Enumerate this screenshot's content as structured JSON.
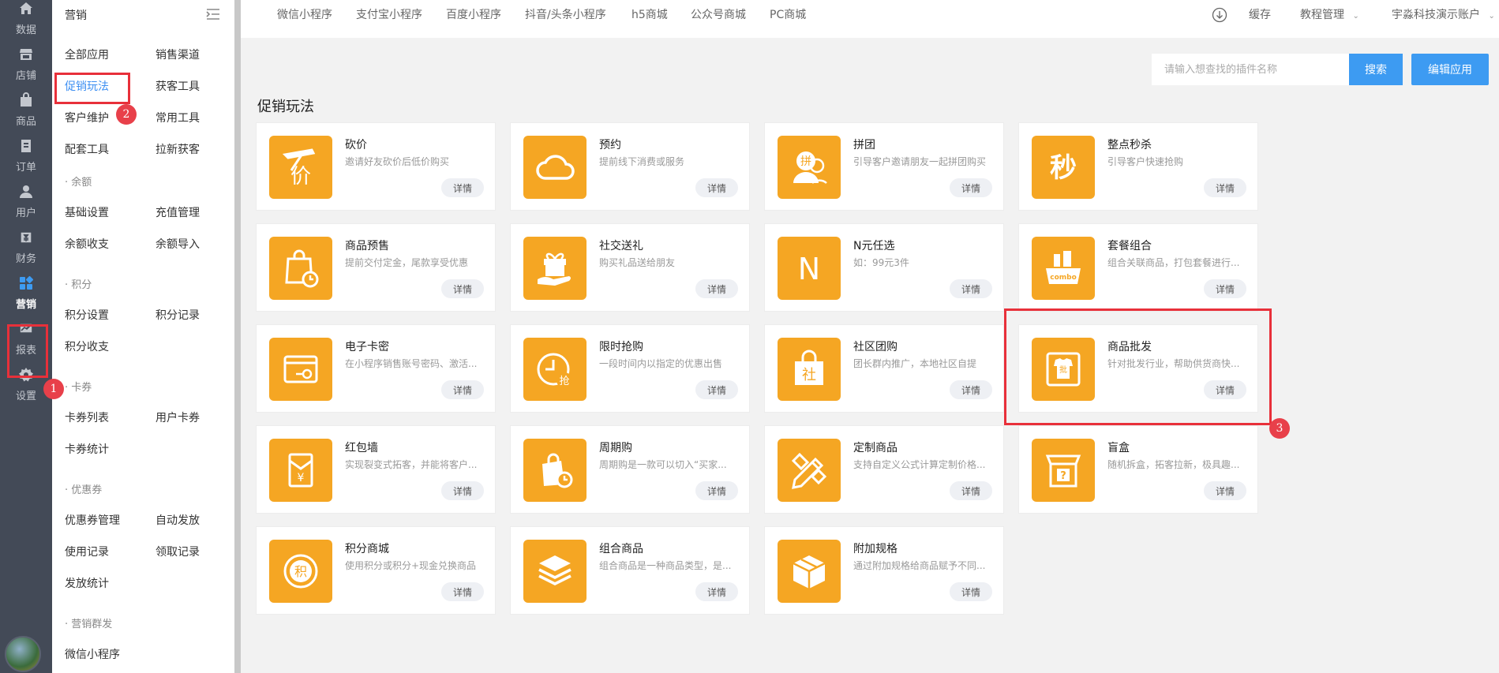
{
  "rail": {
    "items": [
      {
        "label": "数据",
        "icon": "home-icon"
      },
      {
        "label": "店铺",
        "icon": "store-icon"
      },
      {
        "label": "商品",
        "icon": "bag-icon"
      },
      {
        "label": "订单",
        "icon": "order-icon"
      },
      {
        "label": "用户",
        "icon": "user-icon"
      },
      {
        "label": "财务",
        "icon": "finance-icon"
      },
      {
        "label": "营销",
        "icon": "apps-icon"
      },
      {
        "label": "报表",
        "icon": "chart-icon"
      },
      {
        "label": "设置",
        "icon": "gear-icon"
      }
    ],
    "active_index": 6
  },
  "sidebar": {
    "title": "营销",
    "links": {
      "all_apps": "全部应用",
      "sales_channel": "销售渠道",
      "promo_play": "促销玩法",
      "acquire_tools": "获客工具",
      "customer_care": "客户维护",
      "common_tools": "常用工具",
      "bundle_tools": "配套工具",
      "new_acquire": "拉新获客",
      "balance_section": "· 余额",
      "basic_settings": "基础设置",
      "recharge_mgmt": "充值管理",
      "balance_flow": "余额收支",
      "balance_import": "余额导入",
      "points_section": "· 积分",
      "points_settings": "积分设置",
      "points_records": "积分记录",
      "points_flow": "积分收支",
      "coupon_card_section": "· 卡券",
      "card_list": "卡券列表",
      "user_cards": "用户卡券",
      "card_stats": "卡券统计",
      "coupon_section": "· 优惠券",
      "coupon_mgmt": "优惠券管理",
      "auto_issue": "自动发放",
      "usage_records": "使用记录",
      "claim_records": "领取记录",
      "issue_stats": "发放统计",
      "mass_section": "· 营销群发",
      "wechat_mini": "微信小程序"
    }
  },
  "topbar": {
    "tabs": [
      "微信小程序",
      "支付宝小程序",
      "百度小程序",
      "抖音/头条小程序",
      "h5商城",
      "公众号商城",
      "PC商城"
    ],
    "cache": "缓存",
    "tutorial": "教程管理",
    "account": "宇淼科技演示账户"
  },
  "search": {
    "placeholder": "请输入想查找的插件名称",
    "button": "搜索",
    "edit_button": "编辑应用"
  },
  "section_title": "促销玩法",
  "detail_label": "详情",
  "cards": [
    {
      "name": "砍价",
      "desc": "邀请好友砍价后低价购买",
      "icon": "bargain-icon"
    },
    {
      "name": "预约",
      "desc": "提前线下消费或服务",
      "icon": "cloud-icon"
    },
    {
      "name": "拼团",
      "desc": "引导客户邀请朋友一起拼团购买",
      "icon": "group-buy-icon"
    },
    {
      "name": "整点秒杀",
      "desc": "引导客户快速抢购",
      "icon": "flash-sale-icon"
    },
    {
      "name": "商品预售",
      "desc": "提前交付定金，尾款享受优惠",
      "icon": "presale-bag-icon"
    },
    {
      "name": "社交送礼",
      "desc": "购买礼品送给朋友",
      "icon": "gift-icon"
    },
    {
      "name": "N元任选",
      "desc": "如：99元3件",
      "icon": "n-letter-icon"
    },
    {
      "name": "套餐组合",
      "desc": "组合关联商品，打包套餐进行...",
      "icon": "combo-icon"
    },
    {
      "name": "电子卡密",
      "desc": "在小程序销售账号密码、激活...",
      "icon": "card-key-icon"
    },
    {
      "name": "限时抢购",
      "desc": "一段时间内以指定的优惠出售",
      "icon": "timer-icon"
    },
    {
      "name": "社区团购",
      "desc": "团长群内推广，本地社区自提",
      "icon": "community-bag-icon"
    },
    {
      "name": "商品批发",
      "desc": "针对批发行业，帮助供货商快...",
      "icon": "wholesale-icon"
    },
    {
      "name": "红包墙",
      "desc": "实现裂变式拓客，并能将客户...",
      "icon": "red-packet-icon"
    },
    {
      "name": "周期购",
      "desc": "周期购是一款可以切入“买家...",
      "icon": "cycle-bag-icon"
    },
    {
      "name": "定制商品",
      "desc": "支持自定义公式计算定制价格...",
      "icon": "pencil-ruler-icon"
    },
    {
      "name": "盲盒",
      "desc": "随机拆盒，拓客拉新，极具趣...",
      "icon": "mystery-box-icon"
    },
    {
      "name": "积分商城",
      "desc": "使用积分或积分+现金兑换商品",
      "icon": "points-coin-icon"
    },
    {
      "name": "组合商品",
      "desc": "组合商品是一种商品类型，是...",
      "icon": "layers-icon"
    },
    {
      "name": "附加规格",
      "desc": "通过附加规格给商品赋予不同...",
      "icon": "package-box-icon"
    }
  ],
  "icon_glyphs": {
    "bargain": "价",
    "flash": "秒",
    "groupbuy": "拼",
    "n": "N",
    "combo": "combo",
    "timer": "抢",
    "community": "社",
    "wholesale": "批",
    "redpacket": "¥",
    "points": "积"
  },
  "annotations": [
    "1",
    "2",
    "3"
  ],
  "colors": {
    "accent": "#3d9bf2",
    "icon_bg": "#f5a623",
    "rail_bg": "#434a57",
    "highlight": "#e8303a"
  }
}
